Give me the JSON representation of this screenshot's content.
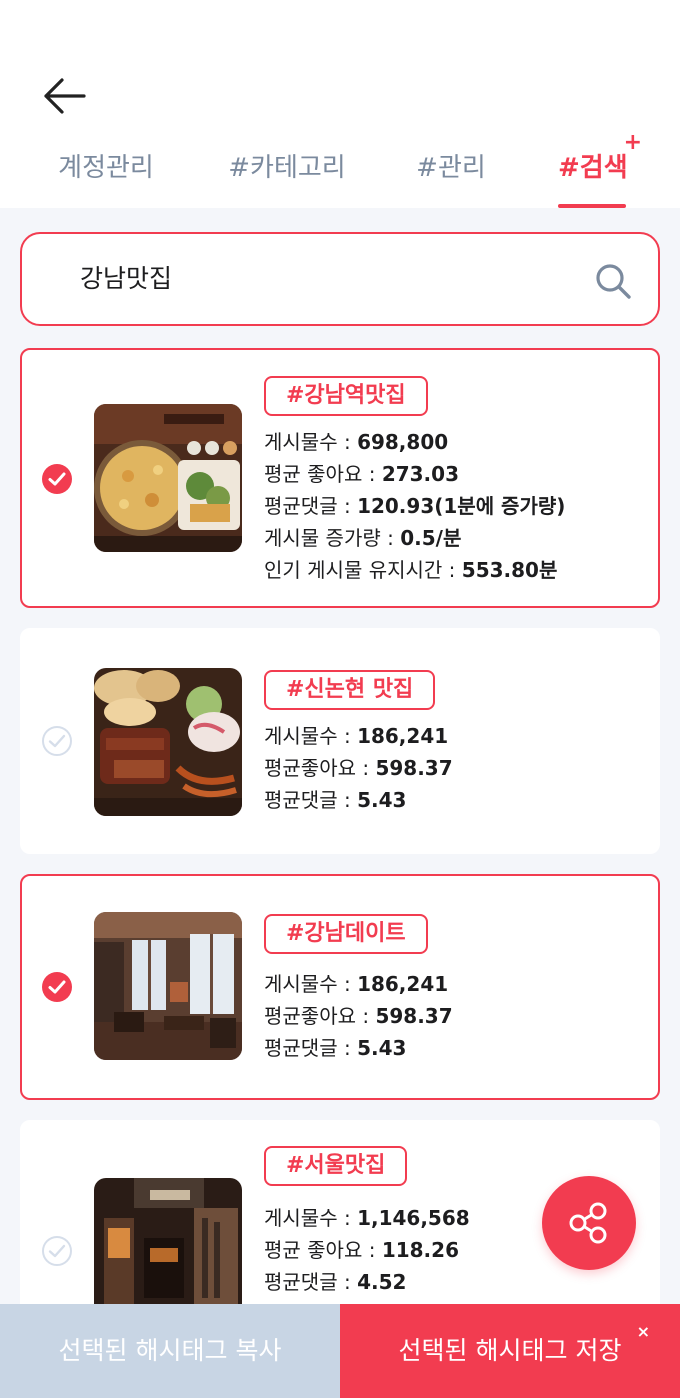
{
  "tabs": [
    {
      "label": "계정관리"
    },
    {
      "label": "#카테고리"
    },
    {
      "label": "#관리"
    },
    {
      "label": "#검색",
      "badge": "+"
    }
  ],
  "search": {
    "value": "강남맛집"
  },
  "results": [
    {
      "tag": "#강남역맛집",
      "selected": true,
      "image": "pizza-dish",
      "stats": [
        {
          "label": "게시물수 : ",
          "value": "698,800"
        },
        {
          "label": "평균 좋아요 : ",
          "value": "273.03"
        },
        {
          "label": "평균댓글 : ",
          "value": "120.93(1분에 증가량)"
        },
        {
          "label": "게시물 증가량 : ",
          "value": "0.5/분"
        },
        {
          "label": "인기 게시물 유지시간 : ",
          "value": "553.80분"
        }
      ]
    },
    {
      "tag": "#신논현 맛집",
      "selected": false,
      "image": "bbq-platter",
      "stats": [
        {
          "label": "게시물수 : ",
          "value": "186,241"
        },
        {
          "label": "평균좋아요 : ",
          "value": "598.37"
        },
        {
          "label": "평균댓글 : ",
          "value": "5.43"
        }
      ]
    },
    {
      "tag": "#강남데이트",
      "selected": true,
      "image": "cafe-interior",
      "stats": [
        {
          "label": "게시물수 : ",
          "value": "186,241"
        },
        {
          "label": "평균좋아요 : ",
          "value": "598.37"
        },
        {
          "label": "평균댓글 : ",
          "value": "5.43"
        }
      ]
    },
    {
      "tag": "#서울맛집",
      "selected": false,
      "image": "restaurant-exterior",
      "stats": [
        {
          "label": "게시물수 : ",
          "value": "1,146,568"
        },
        {
          "label": "평균 좋아요 : ",
          "value": "118.26"
        },
        {
          "label": "평균댓글 : ",
          "value": "4.52"
        }
      ]
    }
  ],
  "actions": {
    "copy_label": "선택된 해시태그 복사",
    "save_label": "선택된 해시태그 저장",
    "save_close": "×"
  },
  "colors": {
    "accent": "#f23c50",
    "muted": "#c8d5e4",
    "tab_inactive": "#7b8a9e"
  },
  "icons": {
    "back": "arrow-left-icon",
    "search": "search-icon",
    "share": "share-icon",
    "check": "check-circle-icon"
  }
}
